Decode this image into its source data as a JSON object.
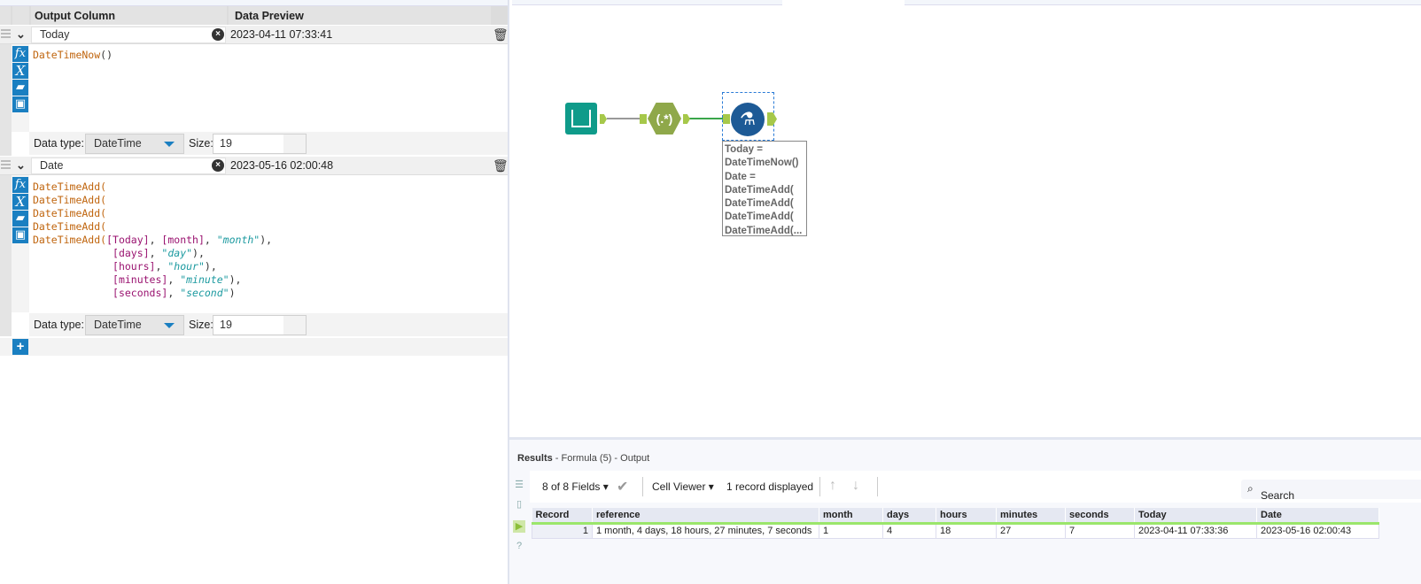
{
  "formula_panel": {
    "headers": {
      "output_column": "Output Column",
      "data_preview": "Data Preview"
    },
    "rows": [
      {
        "name": "Today",
        "preview": "2023-04-11 07:33:41",
        "code": [
          [
            {
              "t": "DateTimeNow",
              "c": "fn"
            },
            {
              "t": "()",
              "c": ""
            }
          ]
        ],
        "data_type": "DateTime",
        "size": "19"
      },
      {
        "name": "Date",
        "preview": "2023-05-16 02:00:48",
        "code": [
          [
            {
              "t": "DateTimeAdd(",
              "c": "fn"
            }
          ],
          [
            {
              "t": "DateTimeAdd(",
              "c": "fn"
            }
          ],
          [
            {
              "t": "DateTimeAdd(",
              "c": "fn"
            }
          ],
          [
            {
              "t": "DateTimeAdd(",
              "c": "fn"
            }
          ],
          [
            {
              "t": "DateTimeAdd(",
              "c": "fn"
            },
            {
              "t": "[Today]",
              "c": "fld"
            },
            {
              "t": ", ",
              "c": ""
            },
            {
              "t": "[month]",
              "c": "fld"
            },
            {
              "t": ", ",
              "c": ""
            },
            {
              "t": "\"month\"",
              "c": "str"
            },
            {
              "t": "),",
              "c": ""
            }
          ],
          [
            {
              "t": "             ",
              "c": ""
            },
            {
              "t": "[days]",
              "c": "fld"
            },
            {
              "t": ", ",
              "c": ""
            },
            {
              "t": "\"day\"",
              "c": "str"
            },
            {
              "t": "),",
              "c": ""
            }
          ],
          [
            {
              "t": "             ",
              "c": ""
            },
            {
              "t": "[hours]",
              "c": "fld"
            },
            {
              "t": ", ",
              "c": ""
            },
            {
              "t": "\"hour\"",
              "c": "str"
            },
            {
              "t": "),",
              "c": ""
            }
          ],
          [
            {
              "t": "             ",
              "c": ""
            },
            {
              "t": "[minutes]",
              "c": "fld"
            },
            {
              "t": ", ",
              "c": ""
            },
            {
              "t": "\"minute\"",
              "c": "str"
            },
            {
              "t": "),",
              "c": ""
            }
          ],
          [
            {
              "t": "             ",
              "c": ""
            },
            {
              "t": "[seconds]",
              "c": "fld"
            },
            {
              "t": ", ",
              "c": ""
            },
            {
              "t": "\"second\"",
              "c": "str"
            },
            {
              "t": ")",
              "c": ""
            }
          ]
        ],
        "data_type": "DateTime",
        "size": "19"
      }
    ],
    "data_type_label": "Data type:",
    "size_label": "Size:",
    "icons": {
      "fx": "fx",
      "var": "X"
    }
  },
  "canvas": {
    "regex_label": "(.*)",
    "annotation": [
      "Today =",
      "DateTimeNow()",
      "Date =",
      "DateTimeAdd(",
      "DateTimeAdd(",
      "DateTimeAdd(",
      "DateTimeAdd(..."
    ]
  },
  "results": {
    "title": "Results",
    "subtitle": " - Formula (5) - Output",
    "fields": "8 of 8 Fields",
    "cell_viewer": "Cell Viewer",
    "records": "1 record displayed",
    "search_placeholder": "Search",
    "columns": [
      "Record",
      "reference",
      "month",
      "days",
      "hours",
      "minutes",
      "seconds",
      "Today",
      "Date"
    ],
    "rows": [
      [
        "1",
        "1 month, 4 days, 18 hours, 27 minutes, 7 seconds",
        "1",
        "4",
        "18",
        "27",
        "7",
        "2023-04-11 07:33:36",
        "2023-05-16 02:00:43"
      ]
    ]
  }
}
